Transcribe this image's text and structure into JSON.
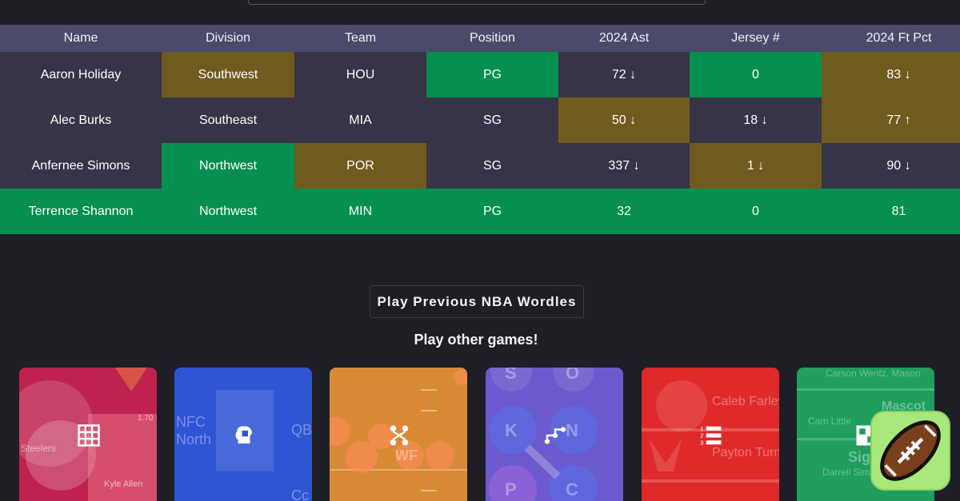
{
  "table": {
    "headers": [
      "Name",
      "Division",
      "Team",
      "Position",
      "2024 Ast",
      "Jersey #",
      "2024 Ft Pct"
    ],
    "rows": [
      {
        "cells": [
          "Aaron Holiday",
          "Southwest",
          "HOU",
          "PG",
          "72 ↓",
          "0",
          "83 ↓"
        ],
        "status": [
          "none",
          "yellow",
          "none",
          "green",
          "none",
          "green",
          "yellow"
        ]
      },
      {
        "cells": [
          "Alec Burks",
          "Southeast",
          "MIA",
          "SG",
          "50 ↓",
          "18 ↓",
          "77 ↑"
        ],
        "status": [
          "none",
          "none",
          "none",
          "none",
          "yellow",
          "none",
          "yellow"
        ]
      },
      {
        "cells": [
          "Anfernee Simons",
          "Northwest",
          "POR",
          "SG",
          "337 ↓",
          "1 ↓",
          "90 ↓"
        ],
        "status": [
          "none",
          "green",
          "yellow",
          "none",
          "none",
          "yellow",
          "none"
        ]
      },
      {
        "cells": [
          "Terrence Shannon",
          "Northwest",
          "MIN",
          "PG",
          "32",
          "0",
          "81"
        ],
        "status": [
          "green",
          "green",
          "green",
          "green",
          "green",
          "green",
          "green"
        ]
      }
    ]
  },
  "prev_button_label": "Play Previous NBA Wordles",
  "other_games_title": "Play other games!",
  "cards": [
    {
      "color": "#c0224f",
      "icon": "grid-icon",
      "texts": [
        "Steelers",
        "Kyle Allen",
        "1.70"
      ]
    },
    {
      "color": "#2f55d4",
      "icon": "brain-puzzle-icon",
      "texts": [
        "NFC",
        "North",
        "QB",
        "Cc"
      ]
    },
    {
      "color": "#d98a35",
      "icon": "team-connect-icon",
      "texts": [
        "WF"
      ]
    },
    {
      "color": "#6a5acd",
      "icon": "path-icon",
      "texts": [
        "S",
        "O",
        "K",
        "N",
        "P",
        "C"
      ]
    },
    {
      "color": "#e02a2a",
      "icon": "ranked-list-icon",
      "texts": [
        "Caleb Farley",
        "Payton Turn"
      ]
    },
    {
      "color": "#1f9e5e",
      "icon": "puzzle-icon",
      "texts": [
        "Carson Wentz, Mason",
        "Mascot",
        "Cam Little",
        "Sig",
        "Darrell Sim"
      ]
    }
  ],
  "colors": {
    "green": "#068f4f",
    "yellow": "#6f5b1f",
    "header": "#4a4a6c",
    "cell": "#363446"
  },
  "fab_icon": "football-icon"
}
